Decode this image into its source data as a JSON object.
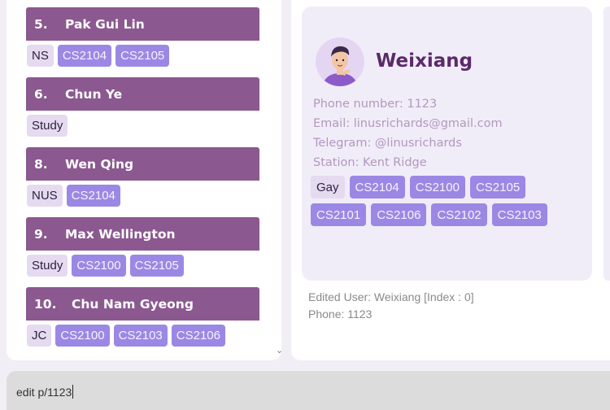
{
  "person_list": [
    {
      "index": "5.",
      "name": "Pak Gui Lin",
      "tags": [
        "NS"
      ],
      "modules": [
        "CS2104",
        "CS2105"
      ]
    },
    {
      "index": "6.",
      "name": "Chun Ye",
      "tags": [
        "Study"
      ],
      "modules": []
    },
    {
      "index": "8.",
      "name": "Wen Qing",
      "tags": [
        "NUS"
      ],
      "modules": [
        "CS2104"
      ]
    },
    {
      "index": "9.",
      "name": "Max Wellington",
      "tags": [
        "Study"
      ],
      "modules": [
        "CS2100",
        "CS2105"
      ]
    },
    {
      "index": "10.",
      "name": "Chu Nam Gyeong",
      "tags": [
        "JC"
      ],
      "modules": [
        "CS2100",
        "CS2103",
        "CS2106"
      ]
    }
  ],
  "profile": {
    "name": "Weixiang",
    "phone": "Phone number: 1123",
    "email": "Email: linusrichards@gmail.com",
    "telegram": "Telegram: @linusrichards",
    "station": "Station: Kent Ridge",
    "tags": [
      "Gay"
    ],
    "modules": [
      "CS2104",
      "CS2100",
      "CS2105",
      "CS2101",
      "CS2106",
      "CS2102",
      "CS2103"
    ]
  },
  "result": {
    "line1": "Edited User: Weixiang [Index : 0]",
    "line2": "Phone: 1123"
  },
  "command": {
    "value": "edit p/1123"
  },
  "icons": {
    "scroll": "chevron-down-icon"
  },
  "colors": {
    "card_header": "#8b5890",
    "module_tag": "#9b88e4",
    "plain_tag": "#e5daf0",
    "profile_name": "#5b2a6a"
  }
}
